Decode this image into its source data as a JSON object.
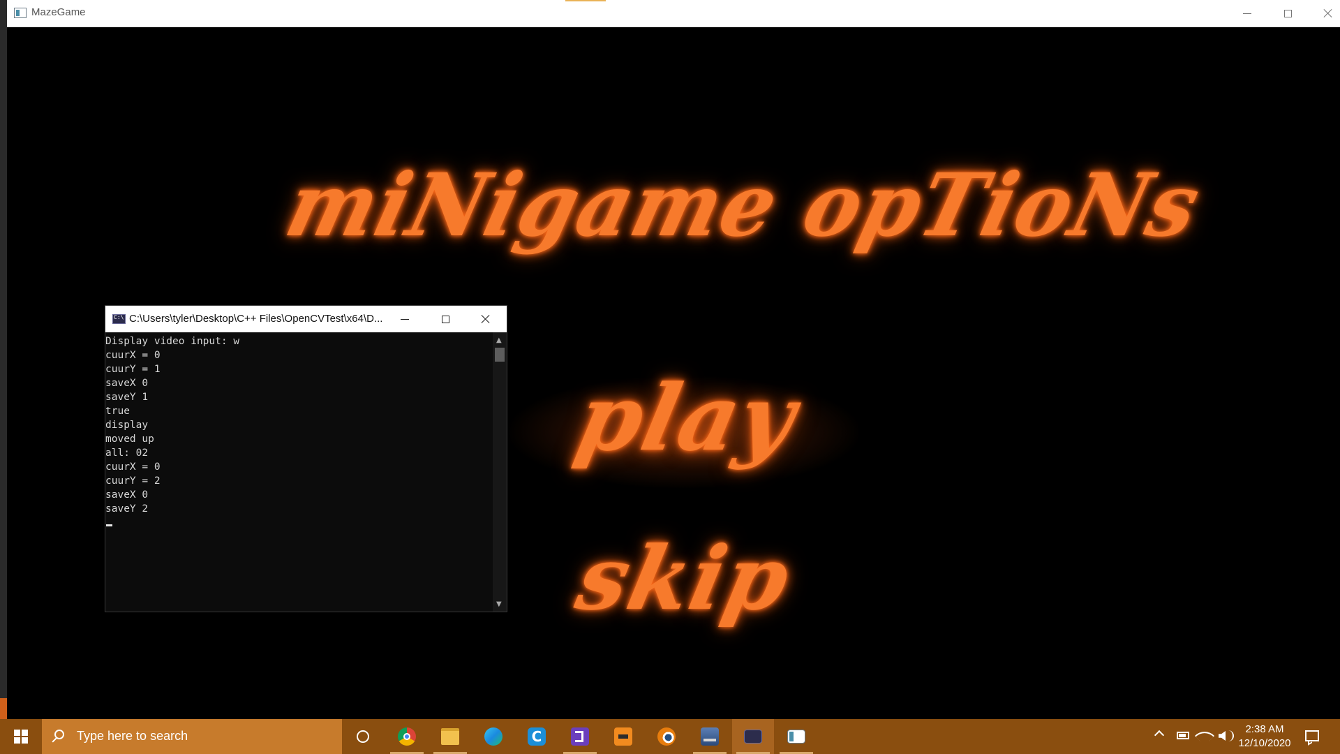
{
  "main_window": {
    "title": "MazeGame"
  },
  "game": {
    "heading": "miNigame opTioNs",
    "play_label": "play",
    "skip_label": "skip",
    "accent_color": "#f77a2c"
  },
  "console": {
    "title": "C:\\Users\\tyler\\Desktop\\C++ Files\\OpenCVTest\\x64\\D...",
    "lines": [
      "Display video input: w",
      "cuurX = 0",
      "cuurY = 1",
      "saveX 0",
      "saveY 1",
      "true",
      "display",
      "moved up",
      "all: 02",
      "cuurX = 0",
      "cuurY = 2",
      "saveX 0",
      "saveY 2"
    ]
  },
  "taskbar": {
    "search_placeholder": "Type here to search",
    "apps": [
      "cortana-icon",
      "chrome-icon",
      "file-explorer-icon",
      "edge-icon",
      "c-app-icon",
      "visual-studio-icon",
      "sublime-icon",
      "blender-icon",
      "network-app-icon",
      "console-icon",
      "mazegame-icon"
    ],
    "clock_time": "2:38 AM",
    "clock_date": "12/10/2020",
    "background_color": "#8a4e0f"
  }
}
